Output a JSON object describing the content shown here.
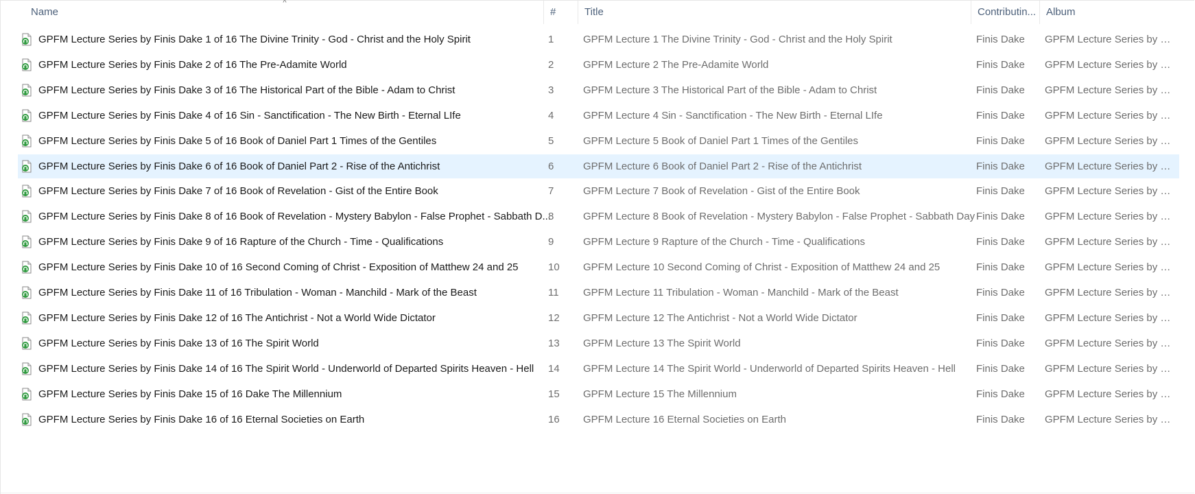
{
  "columns": {
    "name": "Name",
    "num": "#",
    "title": "Title",
    "contributing": "Contributin...",
    "album": "Album"
  },
  "sort_indicator": "^",
  "rows": [
    {
      "name": "GPFM Lecture Series by Finis Dake 1 of 16 The Divine Trinity - God - Christ and the Holy Spirit",
      "num": "1",
      "title": "GPFM Lecture 1 The Divine Trinity - God - Christ and the Holy Spirit",
      "artist": "Finis Dake",
      "album": "GPFM Lecture Series by Fini..."
    },
    {
      "name": "GPFM Lecture Series by Finis Dake 2 of 16 The Pre-Adamite World",
      "num": "2",
      "title": "GPFM Lecture 2 The Pre-Adamite World",
      "artist": "Finis Dake",
      "album": "GPFM Lecture Series by Fini..."
    },
    {
      "name": "GPFM Lecture Series by Finis Dake 3 of 16 The Historical Part of the Bible - Adam to Christ",
      "num": "3",
      "title": "GPFM Lecture 3 The Historical Part of the Bible - Adam to Christ",
      "artist": "Finis Dake",
      "album": "GPFM Lecture Series by Fini..."
    },
    {
      "name": "GPFM Lecture Series by Finis Dake 4 of 16 Sin - Sanctification - The New Birth - Eternal LIfe",
      "num": "4",
      "title": "GPFM Lecture 4 Sin - Sanctification - The New Birth - Eternal LIfe",
      "artist": "Finis Dake",
      "album": "GPFM Lecture Series by Fini..."
    },
    {
      "name": "GPFM Lecture Series by Finis Dake 5 of 16 Book of Daniel Part 1 Times of the Gentiles",
      "num": "5",
      "title": "GPFM Lecture 5 Book of Daniel Part 1 Times of the Gentiles",
      "artist": "Finis Dake",
      "album": "GPFM Lecture Series by Fini..."
    },
    {
      "name": "GPFM Lecture Series by Finis Dake 6 of 16 Book of Daniel Part 2 - Rise of the Antichrist",
      "num": "6",
      "title": "GPFM Lecture 6 Book of Daniel Part 2 - Rise of the Antichrist",
      "artist": "Finis Dake",
      "album": "GPFM Lecture Series by Fini...",
      "selected": true
    },
    {
      "name": "GPFM Lecture Series by Finis Dake 7 of 16 Book of Revelation - Gist of the Entire Book",
      "num": "7",
      "title": "GPFM Lecture 7 Book of Revelation - Gist of the Entire Book",
      "artist": "Finis Dake",
      "album": "GPFM Lecture Series by Fini..."
    },
    {
      "name": "GPFM Lecture Series by Finis Dake 8 of 16 Book of Revelation - Mystery Babylon - False Prophet - Sabbath D...",
      "num": "8",
      "title": "GPFM Lecture 8 Book of Revelation - Mystery Babylon - False Prophet - Sabbath Day",
      "artist": "Finis Dake",
      "album": "GPFM Lecture Series by Fini..."
    },
    {
      "name": "GPFM Lecture Series by Finis Dake 9 of 16 Rapture of the Church - Time - Qualifications",
      "num": "9",
      "title": "GPFM Lecture 9 Rapture of the Church - Time - Qualifications",
      "artist": "Finis Dake",
      "album": "GPFM Lecture Series by Fini..."
    },
    {
      "name": "GPFM Lecture Series by Finis Dake 10 of 16 Second Coming of Christ - Exposition of Matthew 24 and 25",
      "num": "10",
      "title": "GPFM Lecture 10 Second Coming of Christ - Exposition of Matthew 24 and 25",
      "artist": "Finis Dake",
      "album": "GPFM Lecture Series by Fini..."
    },
    {
      "name": "GPFM Lecture Series by Finis Dake 11 of 16 Tribulation - Woman - Manchild - Mark of the Beast",
      "num": "11",
      "title": "GPFM Lecture 11 Tribulation - Woman - Manchild - Mark of the Beast",
      "artist": "Finis Dake",
      "album": "GPFM Lecture Series by Fini..."
    },
    {
      "name": "GPFM Lecture Series by Finis Dake 12 of 16 The Antichrist - Not a World Wide Dictator",
      "num": "12",
      "title": "GPFM Lecture 12 The Antichrist - Not a World Wide Dictator",
      "artist": "Finis Dake",
      "album": "GPFM Lecture Series by Fini..."
    },
    {
      "name": "GPFM Lecture Series by Finis Dake 13 of 16 The Spirit World",
      "num": "13",
      "title": "GPFM Lecture 13 The Spirit World",
      "artist": "Finis Dake",
      "album": "GPFM Lecture Series by Fini..."
    },
    {
      "name": "GPFM Lecture Series by Finis Dake 14 of 16 The Spirit World - Underworld of Departed Spirits Heaven - Hell",
      "num": "14",
      "title": "GPFM Lecture 14 The Spirit World - Underworld of Departed Spirits Heaven - Hell",
      "artist": "Finis Dake",
      "album": "GPFM Lecture Series by Fini..."
    },
    {
      "name": "GPFM Lecture Series by Finis Dake 15 of 16 Dake The Millennium",
      "num": "15",
      "title": "GPFM Lecture 15 The Millennium",
      "artist": "Finis Dake",
      "album": "GPFM Lecture Series by Fini..."
    },
    {
      "name": "GPFM Lecture Series by Finis Dake 16 of 16 Eternal Societies on Earth",
      "num": "16",
      "title": "GPFM Lecture 16 Eternal Societies on Earth",
      "artist": "Finis Dake",
      "album": "GPFM Lecture Series by Fini..."
    }
  ],
  "file_icon": "audio-file-icon",
  "colors": {
    "header_text": "#4c607a",
    "selected_row": "#e5f3ff",
    "secondary_text": "#6d6d6d"
  }
}
